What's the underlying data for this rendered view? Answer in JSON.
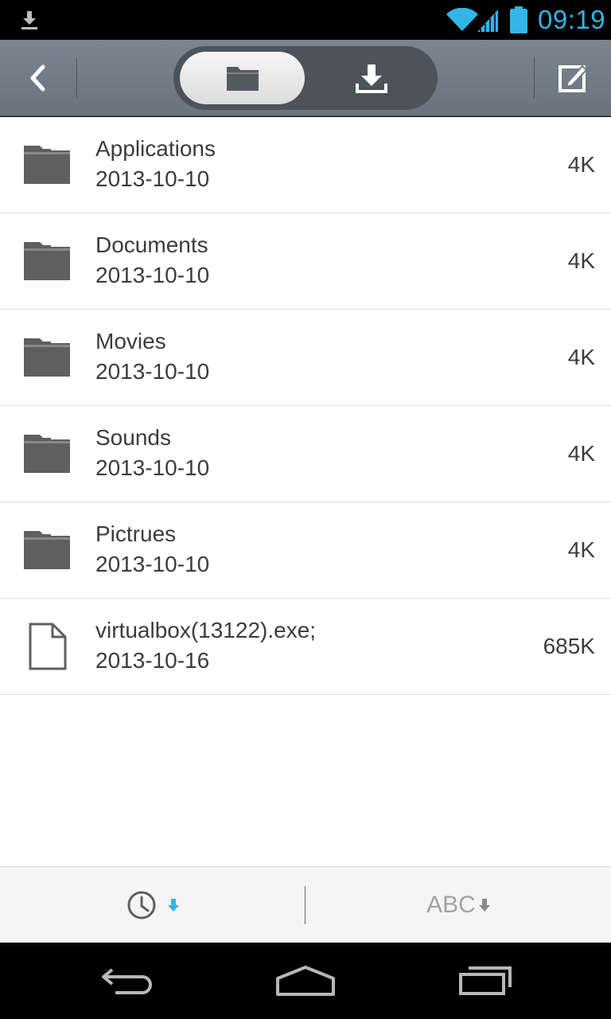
{
  "status_bar": {
    "time": "09:19",
    "icons": [
      "download-notification-icon",
      "wifi-icon",
      "signal-icon",
      "battery-icon"
    ]
  },
  "action_bar": {
    "icons": [
      "back-icon",
      "folder-icon",
      "download-icon",
      "edit-icon"
    ],
    "selected_segment": "folder"
  },
  "files": [
    {
      "name": "Applications",
      "date": "2013-10-10",
      "size": "4K",
      "type": "folder"
    },
    {
      "name": "Documents",
      "date": "2013-10-10",
      "size": "4K",
      "type": "folder"
    },
    {
      "name": "Movies",
      "date": "2013-10-10",
      "size": "4K",
      "type": "folder"
    },
    {
      "name": "Sounds",
      "date": "2013-10-10",
      "size": "4K",
      "type": "folder"
    },
    {
      "name": "Pictrues",
      "date": "2013-10-10",
      "size": "4K",
      "type": "folder"
    },
    {
      "name": "virtualbox(13122).exe;",
      "date": "2013-10-16",
      "size": "685K",
      "type": "file"
    }
  ],
  "sort_bar": {
    "name_label": "ABC",
    "icons": [
      "clock-icon",
      "sort-down-arrow-icon"
    ],
    "active_color": "#33b5e5",
    "inactive_color": "#a3a3a3"
  },
  "nav_bar": {
    "icons": [
      "back-nav-icon",
      "home-nav-icon",
      "recent-apps-icon"
    ]
  },
  "colors": {
    "accent": "#33b5e5",
    "action_bar": "#737c87",
    "folder_icon": "#5f5f5f"
  }
}
